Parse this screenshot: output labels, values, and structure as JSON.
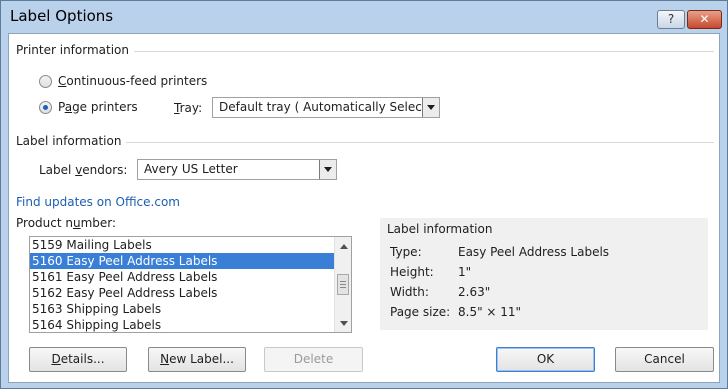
{
  "window": {
    "title": "Label Options",
    "help_glyph": "?",
    "close_glyph": "✕"
  },
  "printer_info": {
    "heading": "Printer information",
    "continuous_label_accel": "C",
    "continuous_label_rest": "ontinuous-feed printers",
    "page_label_p1": "P",
    "page_label_accel": "a",
    "page_label_rest": "ge printers",
    "tray_label_accel": "T",
    "tray_label_rest": "ray:",
    "tray_value": "Default tray ( Automatically Select)",
    "selected": "page"
  },
  "label_info_section": {
    "heading": "Label information",
    "vendors_label_p1": "Label ",
    "vendors_label_accel": "v",
    "vendors_label_rest": "endors:",
    "vendors_value": "Avery US Letter"
  },
  "find_updates_link": "Find updates on Office.com",
  "product_number": {
    "label_p1": "Product n",
    "label_accel": "u",
    "label_rest": "mber:",
    "items": [
      "5159 Mailing Labels",
      "5160 Easy Peel Address Labels",
      "5161 Easy Peel Address Labels",
      "5162 Easy Peel Address Labels",
      "5163 Shipping Labels",
      "5164 Shipping Labels"
    ],
    "selected_index": 1
  },
  "label_details": {
    "heading": "Label information",
    "rows": [
      {
        "label": "Type:",
        "value": "Easy Peel Address Labels"
      },
      {
        "label": "Height:",
        "value": "1\""
      },
      {
        "label": "Width:",
        "value": "2.63\""
      },
      {
        "label": "Page size:",
        "value": "8.5\" × 11\""
      }
    ]
  },
  "buttons": {
    "details_accel": "D",
    "details_rest": "etails...",
    "new_label_accel": "N",
    "new_label_rest": "ew Label...",
    "delete": "Delete",
    "ok": "OK",
    "cancel": "Cancel"
  }
}
